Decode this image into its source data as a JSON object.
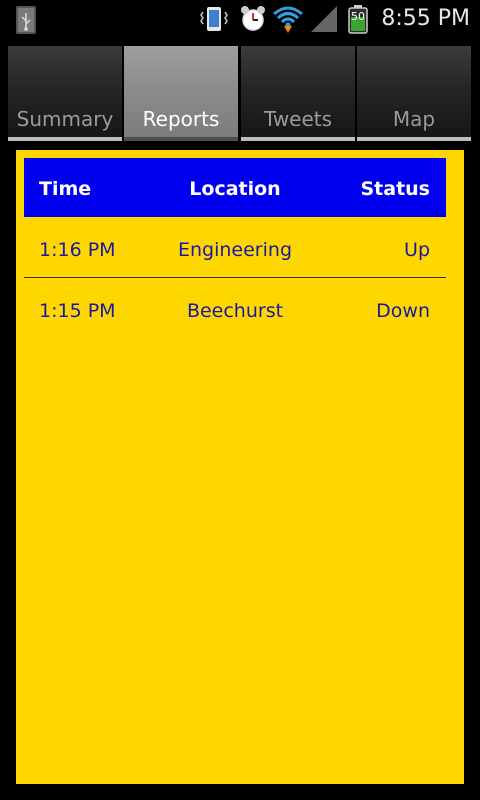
{
  "status_bar": {
    "time": "8:55 PM",
    "battery_level": "50",
    "icons": [
      "usb-icon",
      "vibrate-icon",
      "alarm-icon",
      "wifi-icon",
      "signal-icon",
      "battery-icon"
    ]
  },
  "tabs": [
    {
      "label": "Summary",
      "active": false
    },
    {
      "label": "Reports",
      "active": true
    },
    {
      "label": "Tweets",
      "active": false
    },
    {
      "label": "Map",
      "active": false
    }
  ],
  "table": {
    "headers": {
      "time": "Time",
      "location": "Location",
      "status": "Status"
    },
    "rows": [
      {
        "time": "1:16 PM",
        "location": "Engineering",
        "status": "Up"
      },
      {
        "time": "1:15 PM",
        "location": "Beechurst",
        "status": "Down"
      }
    ]
  },
  "colors": {
    "panel_background": "#ffd700",
    "header_background": "#0000ee",
    "row_text": "#1a1aa0"
  }
}
